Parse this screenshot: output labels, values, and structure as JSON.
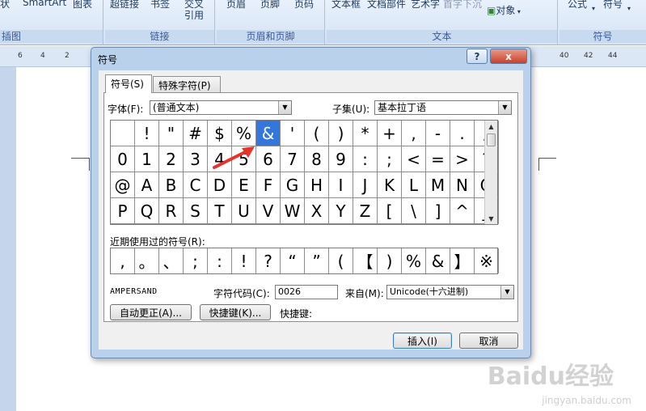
{
  "ribbon": {
    "items": [
      "状",
      "SmartArt",
      "图表",
      "超链接",
      "书签",
      "交叉",
      "引用",
      "页眉",
      "页脚",
      "页码",
      "文本框",
      "文档部件",
      "艺术字",
      "首字下沉",
      "对象",
      "公式",
      "符号"
    ],
    "groups": [
      "插图",
      "链接",
      "页眉和页脚",
      "文本",
      "符号"
    ]
  },
  "ruler": {
    "left_numbers": [
      "6",
      "4",
      "2"
    ],
    "right_numbers": [
      "40",
      "42",
      "44"
    ]
  },
  "dialog": {
    "title": "符号",
    "help_label": "?",
    "close_label": "x",
    "tabs": [
      "符号(S)",
      "特殊字符(P)"
    ],
    "font_label": "字体(F):",
    "font_value": "(普通文本)",
    "subset_label": "子集(U):",
    "subset_value": "基本拉丁语",
    "symbols": [
      " ",
      "!",
      "\"",
      "#",
      "$",
      "%",
      "&",
      "'",
      "(",
      ")",
      "*",
      "+",
      ",",
      "-",
      ".",
      "/",
      "0",
      "1",
      "2",
      "3",
      "4",
      "5",
      "6",
      "7",
      "8",
      "9",
      ":",
      ";",
      "<",
      "=",
      ">",
      "?",
      "@",
      "A",
      "B",
      "C",
      "D",
      "E",
      "F",
      "G",
      "H",
      "I",
      "J",
      "K",
      "L",
      "M",
      "N",
      "O",
      "P",
      "Q",
      "R",
      "S",
      "T",
      "U",
      "V",
      "W",
      "X",
      "Y",
      "Z",
      "[",
      "\\",
      "]",
      "^",
      "_"
    ],
    "selected_symbol": "&",
    "recent_label": "近期使用过的符号(R):",
    "recent_symbols": [
      ",",
      "。",
      "、",
      ";",
      ":",
      "!",
      "?",
      "“",
      "”",
      "(",
      "【",
      ")",
      "%",
      "&",
      "】",
      "※"
    ],
    "char_name": "AMPERSAND",
    "char_code_label": "字符代码(C):",
    "char_code_value": "0026",
    "from_label": "来自(M):",
    "from_value": "Unicode(十六进制)",
    "autocorrect_label": "自动更正(A)...",
    "shortcut_button_label": "快捷键(K)...",
    "shortcut_text": "快捷键:",
    "insert_label": "插入(I)",
    "cancel_label": "取消"
  },
  "watermark": {
    "brand": "Baidu经验",
    "url": "jingyan.baidu.com"
  },
  "colors": {
    "selection": "#3377dd",
    "arrow": "#e8332a",
    "ribbon": "#dbe6f4"
  }
}
